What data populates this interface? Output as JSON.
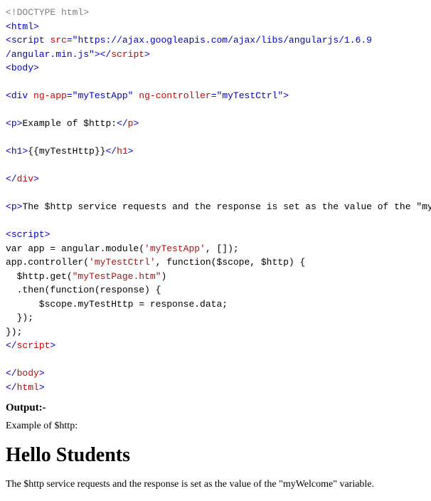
{
  "code": {
    "doctype": "<!DOCTYPE html>",
    "html_open": "html",
    "script_tag": "script",
    "src_attr": "src",
    "src_val_line1": "\"https://ajax.googleapis.com/ajax/libs/angularjs/1.6.9",
    "src_val_line2": "/angular.min.js\"",
    "body_tag": "body",
    "div_tag": "div",
    "ngapp_attr": "ng-app",
    "ngapp_val": "\"myTestApp\"",
    "ngctrl_attr": "ng-controller",
    "ngctrl_val": "\"myTestCtrl\"",
    "p_tag": "p",
    "p_text": "Example of $http:",
    "h1_tag": "h1",
    "h1_text": "{{myTestHttp}}",
    "p2_text": "The $http service requests and the response is set as the value of the \"myTestHttp\" variable.",
    "js_line1": "var app = angular.module(",
    "js_str1": "'myTestApp'",
    "js_line1b": ", []);",
    "js_line2": "app.controller(",
    "js_str2": "'myTestCtrl'",
    "js_line2b": ", function($scope, $http) {",
    "js_line3": "  $http.get(",
    "js_str3": "\"myTestPage.htm\"",
    "js_line3b": ")",
    "js_line4": "  .then(function(response) {",
    "js_line5": "      $scope.myTestHttp = response.data;",
    "js_line6": "  });",
    "js_line7": "});"
  },
  "output": {
    "label": "Output:-",
    "p1": "Example of $http:",
    "h1": "Hello Students",
    "p2": "The $http service requests and the response is set as the value of the \"myWelcome\" variable."
  }
}
